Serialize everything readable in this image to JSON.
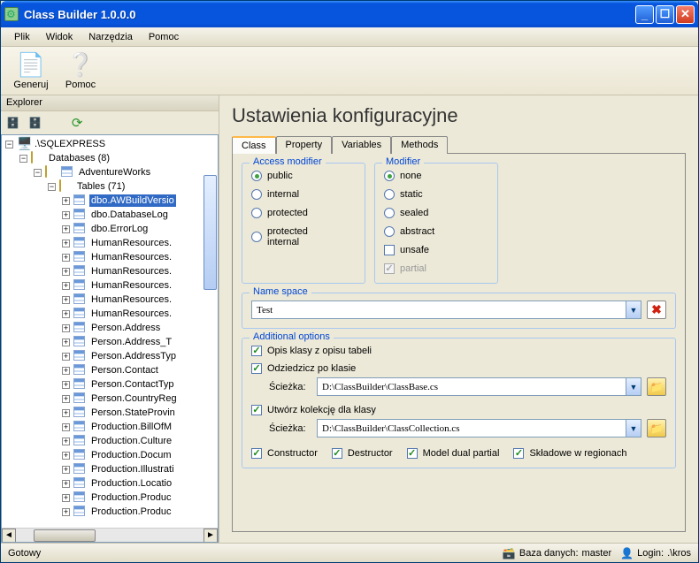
{
  "title": "Class Builder 1.0.0.0",
  "menu": {
    "file": "Plik",
    "view": "Widok",
    "tools": "Narzędzia",
    "help": "Pomoc"
  },
  "toolbar": {
    "generate": "Generuj",
    "help": "Pomoc"
  },
  "sidebar": {
    "title": "Explorer",
    "root": ".\\SQLEXPRESS",
    "databases_label": "Databases (8)",
    "db_name": "AdventureWorks",
    "tables_label": "Tables (71)",
    "tables": [
      "dbo.AWBuildVersio",
      "dbo.DatabaseLog",
      "dbo.ErrorLog",
      "HumanResources.",
      "HumanResources.",
      "HumanResources.",
      "HumanResources.",
      "HumanResources.",
      "HumanResources.",
      "Person.Address",
      "Person.Address_T",
      "Person.AddressTyp",
      "Person.Contact",
      "Person.ContactTyp",
      "Person.CountryReg",
      "Person.StateProvin",
      "Production.BillOfM",
      "Production.Culture",
      "Production.Docum",
      "Production.Illustrati",
      "Production.Locatio",
      "Production.Produc",
      "Production.Produc"
    ],
    "selected_index": 0
  },
  "main": {
    "heading": "Ustawienia konfiguracyjne",
    "tabs": {
      "class": "Class",
      "property": "Property",
      "variables": "Variables",
      "methods": "Methods"
    },
    "access": {
      "title": "Access modifier",
      "options": [
        "public",
        "internal",
        "protected",
        "protected internal"
      ],
      "selected": 0
    },
    "modifier": {
      "title": "Modifier",
      "options": [
        "none",
        "static",
        "sealed",
        "abstract"
      ],
      "selected": 0,
      "unsafe": "unsafe",
      "unsafe_checked": false,
      "partial": "partial",
      "partial_checked": true
    },
    "namespace": {
      "title": "Name space",
      "value": "Test"
    },
    "additional": {
      "title": "Additional options",
      "opt_desc": "Opis klasy z opisu tabeli",
      "opt_inherit": "Odziedzicz po klasie",
      "opt_collection": "Utwórz kolekcję dla klasy",
      "path_label": "Ścieżka:",
      "path1": "D:\\ClassBuilder\\ClassBase.cs",
      "path2": "D:\\ClassBuilder\\ClassCollection.cs",
      "constructor": "Constructor",
      "destructor": "Destructor",
      "model": "Model dual partial",
      "regions": "Składowe w regionach"
    }
  },
  "status": {
    "ready": "Gotowy",
    "db_label": "Baza danych:",
    "db_value": "master",
    "login_label": "Login:",
    "login_value": ".\\kros"
  }
}
